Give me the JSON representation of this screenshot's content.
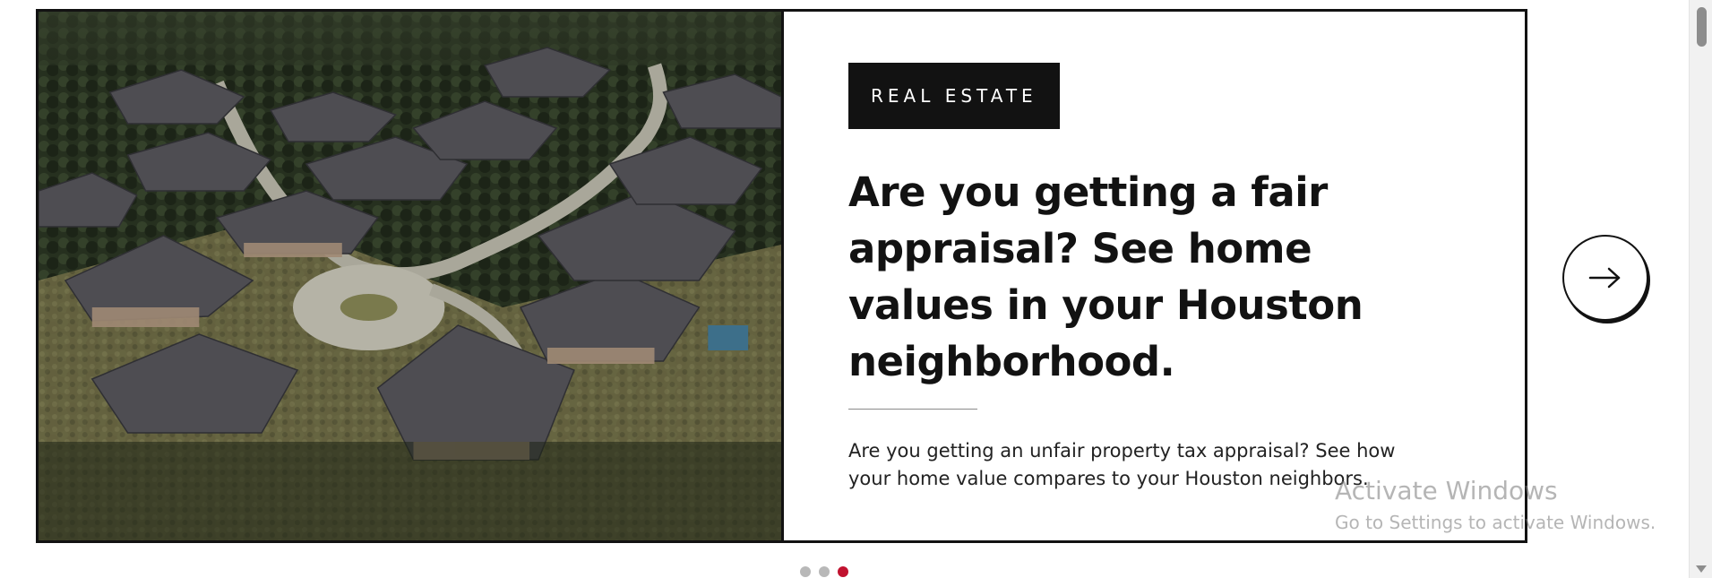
{
  "carousel": {
    "slide": {
      "category": "REAL ESTATE",
      "headline": "Are you getting a fair appraisal? See home values in your Houston neighborhood.",
      "dek": "Are you getting an unfair property tax appraisal? See how your home value compares to your Houston neighbors.",
      "image_icon": "aerial-neighborhood-photo"
    },
    "next_icon": "arrow-right-icon",
    "dots": [
      {
        "state": "inactive"
      },
      {
        "state": "inactive"
      },
      {
        "state": "active"
      }
    ],
    "active_dot_color": "#c1122f",
    "inactive_dot_color": "#b8b8b8"
  },
  "watermark": {
    "title": "Activate Windows",
    "subtitle": "Go to Settings to activate Windows."
  }
}
